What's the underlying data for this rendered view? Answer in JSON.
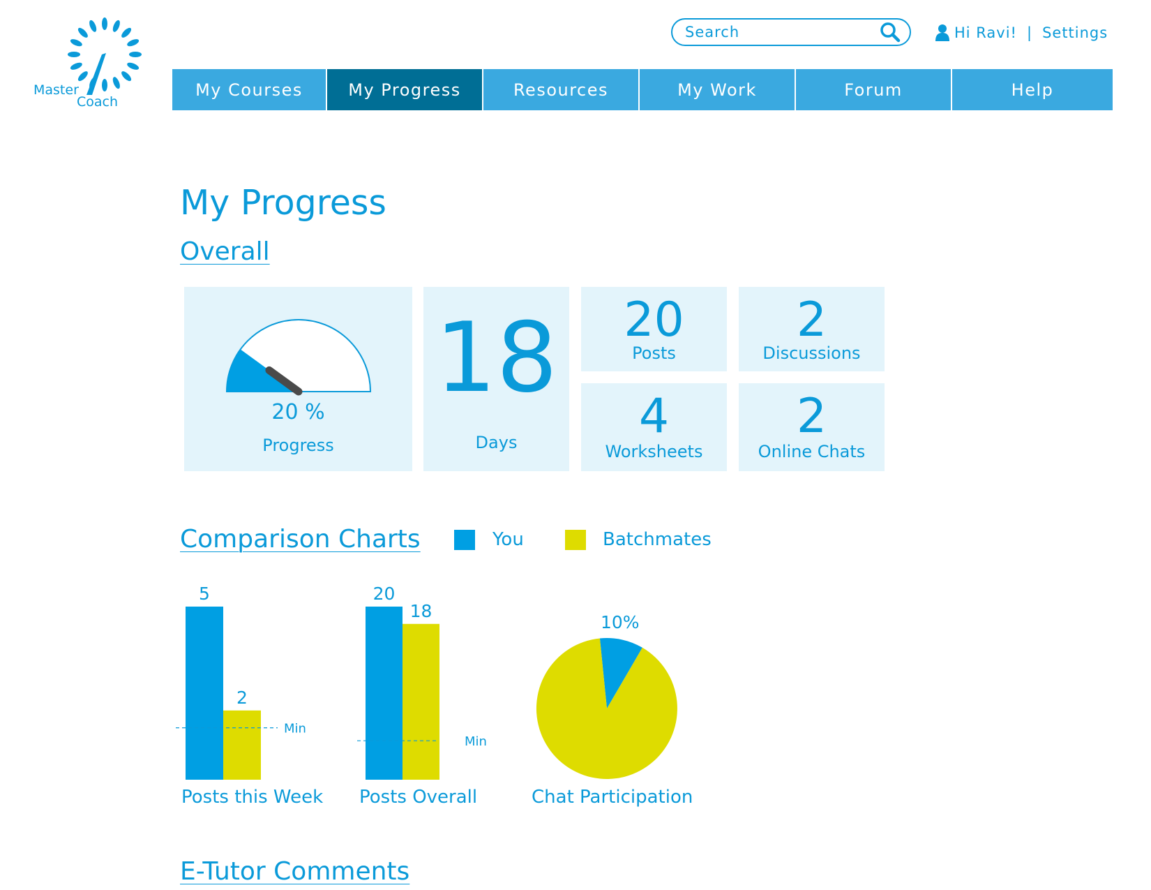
{
  "brand": {
    "logo_line1": "Master",
    "logo_line2": "Coach"
  },
  "search": {
    "placeholder": "Search"
  },
  "user": {
    "greeting": "Hi Ravi!",
    "separator": "|",
    "settings_label": "Settings"
  },
  "nav": {
    "items": [
      {
        "label": "My Courses"
      },
      {
        "label": "My Progress",
        "active": true
      },
      {
        "label": "Resources"
      },
      {
        "label": "My Work"
      },
      {
        "label": "Forum"
      },
      {
        "label": "Help"
      }
    ]
  },
  "page": {
    "title": "My Progress"
  },
  "overall": {
    "heading": "Overall",
    "progress": {
      "value_text": "20 %",
      "value": 20,
      "label": "Progress"
    },
    "days": {
      "value": "18",
      "label": "Days"
    },
    "posts": {
      "value": "20",
      "label": "Posts"
    },
    "discussions": {
      "value": "2",
      "label": "Discussions"
    },
    "worksheets": {
      "value": "4",
      "label": "Worksheets"
    },
    "online_chats": {
      "value": "2",
      "label": "Online Chats"
    }
  },
  "comparison": {
    "heading": "Comparison Charts",
    "legend": [
      {
        "label": "You",
        "color": "#009fe3"
      },
      {
        "label": "Batchmates",
        "color": "#dedc00"
      }
    ]
  },
  "chart_data": [
    {
      "type": "bar",
      "title": "Posts this Week",
      "categories": [
        "Posts this Week"
      ],
      "series": [
        {
          "name": "You",
          "values": [
            5
          ]
        },
        {
          "name": "Batchmates",
          "values": [
            2
          ]
        }
      ],
      "min_line": {
        "label": "Min",
        "value": 1.5
      },
      "ylim": [
        0,
        5
      ]
    },
    {
      "type": "bar",
      "title": "Posts Overall",
      "categories": [
        "Posts Overall"
      ],
      "series": [
        {
          "name": "You",
          "values": [
            20
          ]
        },
        {
          "name": "Batchmates",
          "values": [
            18
          ]
        }
      ],
      "min_line": {
        "label": "Min",
        "value": 4.5
      },
      "ylim": [
        0,
        20
      ]
    },
    {
      "type": "pie",
      "title": "Chat Participation",
      "slices": [
        {
          "name": "You",
          "value": 10,
          "label": "10%"
        },
        {
          "name": "Batchmates",
          "value": 90
        }
      ]
    }
  ],
  "etutor": {
    "heading": "E-Tutor Comments"
  }
}
